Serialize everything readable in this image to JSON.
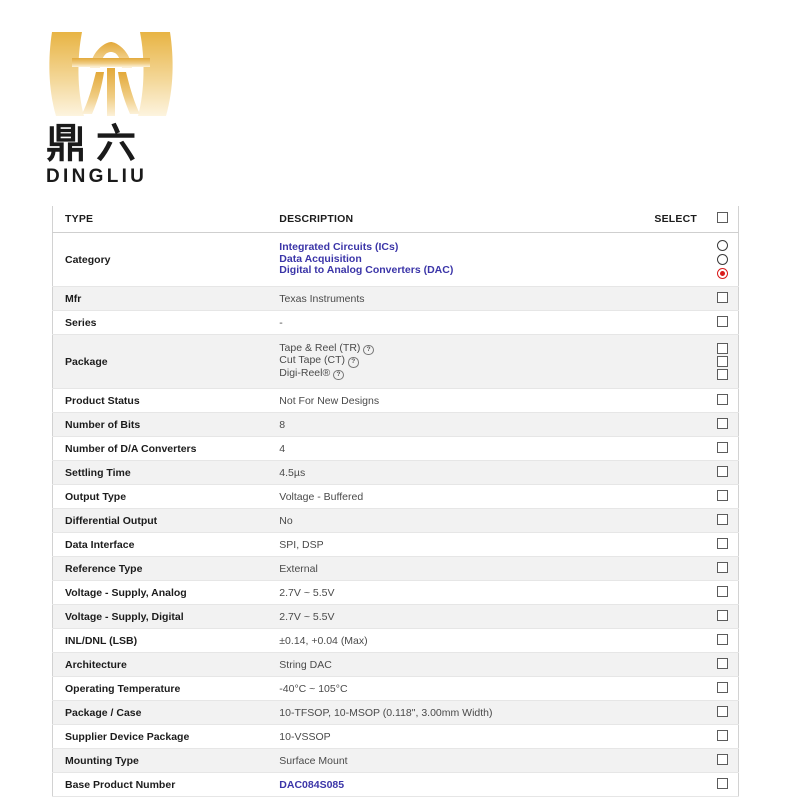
{
  "brand": {
    "chinese_name": "鼎六",
    "latin_name": "DINGLIU",
    "logo_icon": "dingliu-gold-emblem",
    "gold_light": "#f6e3b0",
    "gold_dark": "#e0a93c"
  },
  "table": {
    "headers": {
      "type": "TYPE",
      "description": "DESCRIPTION",
      "select": "SELECT"
    },
    "link_color": "#3b35a8",
    "selected_radio_color": "#d91c1c",
    "rows": [
      {
        "type": "Category",
        "control": "radio",
        "values": [
          "Integrated Circuits (ICs)",
          "Data Acquisition",
          "Digital to Analog Converters (DAC)"
        ],
        "selected_index": 2,
        "is_link": true
      },
      {
        "type": "Mfr",
        "control": "checkbox",
        "values": [
          "Texas Instruments"
        ]
      },
      {
        "type": "Series",
        "control": "checkbox",
        "values": [
          "-"
        ]
      },
      {
        "type": "Package",
        "control": "checkbox",
        "values": [
          "Tape & Reel (TR)",
          "Cut Tape (CT)",
          "Digi-Reel®"
        ],
        "has_help": true,
        "help_icon": "question-mark-circle-icon"
      },
      {
        "type": "Product Status",
        "control": "checkbox",
        "values": [
          "Not For New Designs"
        ]
      },
      {
        "type": "Number of Bits",
        "control": "checkbox",
        "values": [
          "8"
        ]
      },
      {
        "type": "Number of D/A Converters",
        "control": "checkbox",
        "values": [
          "4"
        ]
      },
      {
        "type": "Settling Time",
        "control": "checkbox",
        "values": [
          "4.5µs"
        ]
      },
      {
        "type": "Output Type",
        "control": "checkbox",
        "values": [
          "Voltage - Buffered"
        ]
      },
      {
        "type": "Differential Output",
        "control": "checkbox",
        "values": [
          "No"
        ]
      },
      {
        "type": "Data Interface",
        "control": "checkbox",
        "values": [
          "SPI, DSP"
        ]
      },
      {
        "type": "Reference Type",
        "control": "checkbox",
        "values": [
          "External"
        ]
      },
      {
        "type": "Voltage - Supply, Analog",
        "control": "checkbox",
        "values": [
          "2.7V ~ 5.5V"
        ]
      },
      {
        "type": "Voltage - Supply, Digital",
        "control": "checkbox",
        "values": [
          "2.7V ~ 5.5V"
        ]
      },
      {
        "type": "INL/DNL (LSB)",
        "control": "checkbox",
        "values": [
          "±0.14, +0.04 (Max)"
        ]
      },
      {
        "type": "Architecture",
        "control": "checkbox",
        "values": [
          "String DAC"
        ]
      },
      {
        "type": "Operating Temperature",
        "control": "checkbox",
        "values": [
          "-40°C ~ 105°C"
        ]
      },
      {
        "type": "Package / Case",
        "control": "checkbox",
        "values": [
          "10-TFSOP, 10-MSOP (0.118\", 3.00mm Width)"
        ]
      },
      {
        "type": "Supplier Device Package",
        "control": "checkbox",
        "values": [
          "10-VSSOP"
        ]
      },
      {
        "type": "Mounting Type",
        "control": "checkbox",
        "values": [
          "Surface Mount"
        ]
      },
      {
        "type": "Base Product Number",
        "control": "checkbox",
        "values": [
          "DAC084S085"
        ],
        "is_link": true
      }
    ]
  }
}
